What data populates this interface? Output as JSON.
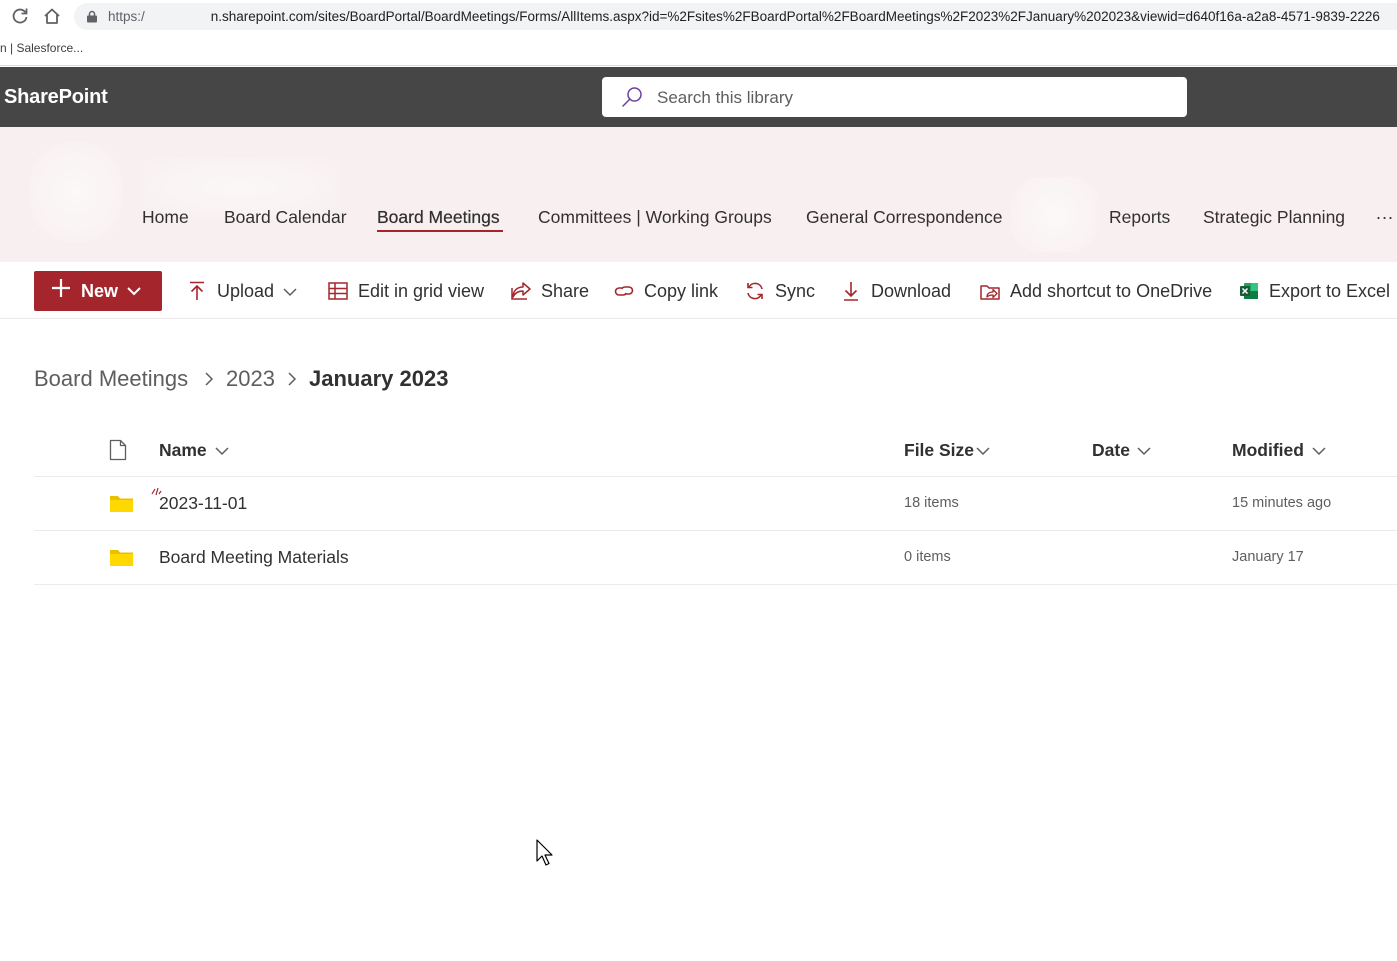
{
  "browser": {
    "url_prefix": "https:/",
    "url_rest": "n.sharepoint.com/sites/BoardPortal/BoardMeetings/Forms/AllItems.aspx?id=%2Fsites%2FBoardPortal%2FBoardMeetings%2F2023%2FJanuary%202023&viewid=d640f16a-a2a8-4571-9839-2226",
    "bookmark": "n | Salesforce..."
  },
  "suite": {
    "brand": "SharePoint",
    "search_placeholder": "Search this library"
  },
  "site_nav": {
    "items": [
      {
        "label": "Home"
      },
      {
        "label": "Board Calendar"
      },
      {
        "label": "Board Meetings"
      },
      {
        "label": "Committees | Working Groups"
      },
      {
        "label": "General Correspondence"
      },
      {
        "label": "Reports"
      },
      {
        "label": "Strategic Planning"
      }
    ],
    "active": "Board Meetings",
    "more": "..."
  },
  "commands": {
    "new": "New",
    "upload": "Upload",
    "edit_grid": "Edit in grid view",
    "share": "Share",
    "copy_link": "Copy link",
    "sync": "Sync",
    "download": "Download",
    "add_shortcut": "Add shortcut to OneDrive",
    "export_excel": "Export to Excel"
  },
  "breadcrumb": [
    "Board Meetings",
    "2023",
    "January 2023"
  ],
  "columns": {
    "name": "Name",
    "file_size": "File Size",
    "date": "Date",
    "modified": "Modified"
  },
  "rows": [
    {
      "name": "2023-11-01",
      "file_size": "18 items",
      "date": "",
      "modified": "15 minutes ago",
      "is_new": true
    },
    {
      "name": "Board Meeting Materials",
      "file_size": "0 items",
      "date": "",
      "modified": "January 17",
      "is_new": false
    }
  ],
  "colors": {
    "accent": "#a4262c",
    "suite_bar": "#464646",
    "header_bg": "#f8f0f0",
    "folder": "#ffd800"
  }
}
